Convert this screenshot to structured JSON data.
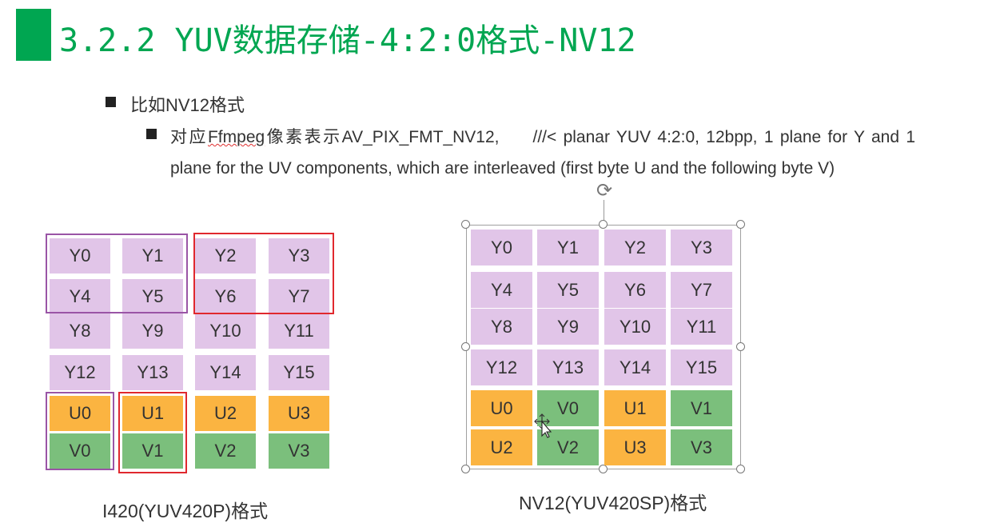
{
  "slide": {
    "title": "3.2.2 YUV数据存储-4:2:0格式-NV12",
    "bullet1": "比如NV12格式",
    "para": {
      "prefix": "对应",
      "misspelled": "Ffmpeg",
      "middle": "像素表示AV_PIX_FMT_NV12,",
      "comment": "///< planar YUV 4:2:0, 12bpp, 1 plane for Y and 1 plane for the UV components, which are interleaved (first byte U and the following byte V)"
    },
    "caption_i420": "I420(YUV420P)格式",
    "caption_nv12": "NV12(YUV420SP)格式"
  },
  "i420_grid": {
    "rows": [
      [
        "Y0",
        "Y1",
        "Y2",
        "Y3"
      ],
      [
        "Y4",
        "Y5",
        "Y6",
        "Y7"
      ],
      [
        "Y8",
        "Y9",
        "Y10",
        "Y11"
      ],
      [
        "Y12",
        "Y13",
        "Y14",
        "Y15"
      ],
      [
        "U0",
        "U1",
        "U2",
        "U3"
      ],
      [
        "V0",
        "V1",
        "V2",
        "V3"
      ]
    ]
  },
  "nv12_grid": {
    "rows": [
      [
        "Y0",
        "Y1",
        "Y2",
        "Y3"
      ],
      [
        "Y4",
        "Y5",
        "Y6",
        "Y7"
      ],
      [
        "Y8",
        "Y9",
        "Y10",
        "Y11"
      ],
      [
        "Y12",
        "Y13",
        "Y14",
        "Y15"
      ],
      [
        "U0",
        "V0",
        "U1",
        "V1"
      ],
      [
        "U2",
        "V2",
        "U3",
        "V3"
      ]
    ]
  },
  "colors": {
    "title_green": "#00a651",
    "y_fill": "#e1c5e8",
    "u_fill": "#fbb441",
    "v_fill": "#7bbf7c",
    "highlight_purple": "#9a55a6",
    "highlight_red": "#e0282e"
  },
  "icons": {
    "bullet": "square-bullet-icon",
    "rotate": "rotate-handle-icon",
    "cursor": "move-cursor-icon"
  }
}
